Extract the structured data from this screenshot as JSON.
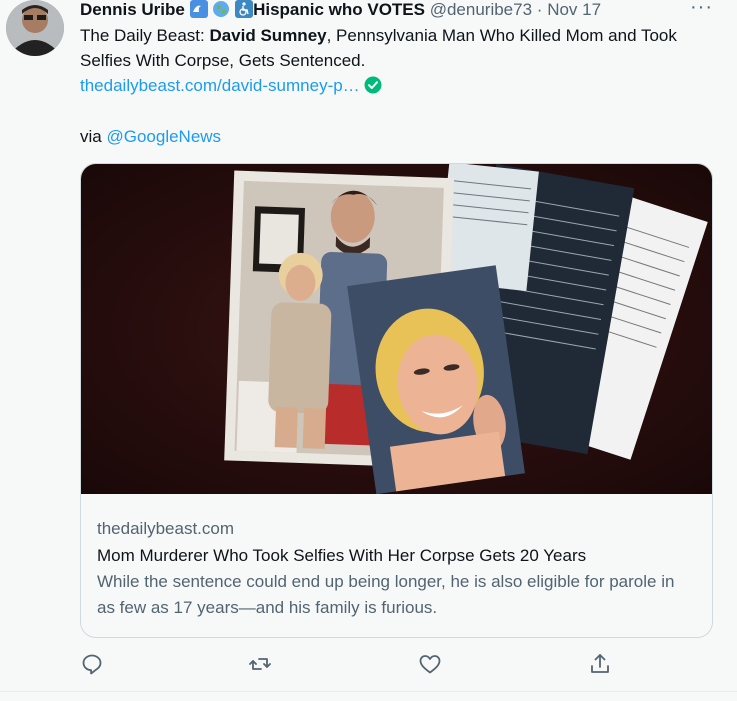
{
  "tweet": {
    "author_name": "Dennis Uribe",
    "author_suffix": "Hispanic who VOTES",
    "handle": "@denuribe73",
    "separator": "·",
    "date": "Nov 17",
    "more_label": "···",
    "text_prefix": "The Daily Beast: ",
    "text_bold": "David Sumney",
    "text_rest": ", Pennsylvania Man Who Killed Mom and Took Selfies With Corpse, Gets Sentenced.",
    "link_text": "thedailybeast.com/david-sumney-p…",
    "via_prefix": "via ",
    "via_mention": "@GoogleNews",
    "emojis": [
      "wave-emoji",
      "globe-emoji",
      "wheelchair-emoji"
    ]
  },
  "card": {
    "domain": "thedailybeast.com",
    "title": "Mom Murderer Who Took Selfies With Her Corpse Gets 20 Years",
    "description": "While the sentence could end up being longer, he is also eligible for parole in as few as 17 years—and his family is furious."
  },
  "actions": [
    "reply-icon",
    "retweet-icon",
    "like-icon",
    "share-icon"
  ],
  "colors": {
    "link": "#1d9bf0",
    "secondary": "#536471",
    "verified": "#00ba7c",
    "image_bg": "#2a0d0d"
  }
}
